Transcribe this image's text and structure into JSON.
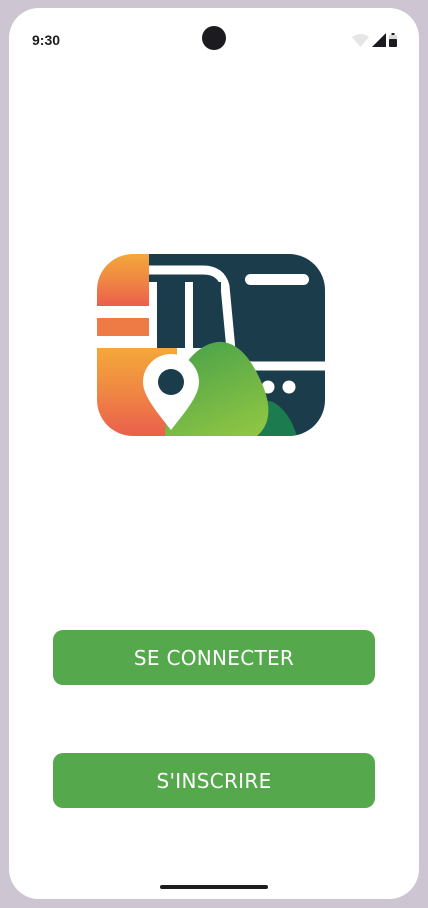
{
  "status_bar": {
    "time": "9:30",
    "icons": [
      "wifi-icon",
      "signal-icon",
      "battery-icon"
    ]
  },
  "logo": {
    "icon": "bus-with-location-pin-logo",
    "colors": {
      "dark_teal": "#1b3c4b",
      "orange": "#f2a33a",
      "red": "#ec6a4c",
      "green": "#5aa845",
      "dark_green": "#1d7c4f"
    }
  },
  "actions": {
    "login_label": "SE CONNECTER",
    "register_label": "S'INSCRIRE"
  },
  "theme": {
    "button_color": "#55a84b",
    "background": "#ffffff",
    "frame": "#cdc5d1"
  }
}
